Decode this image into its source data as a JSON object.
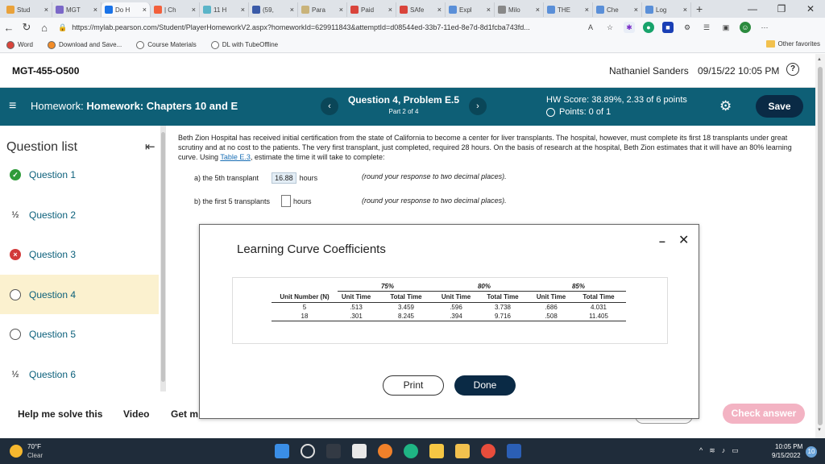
{
  "browser": {
    "tabs": [
      {
        "label": "Stud",
        "color": "#e9a23b"
      },
      {
        "label": "MGT",
        "color": "#7b68c8"
      },
      {
        "label": "Do H",
        "color": "#1a73e8",
        "active": true
      },
      {
        "label": "| Ch",
        "color": "#f2603c"
      },
      {
        "label": "11 H",
        "color": "#5ab4c8"
      },
      {
        "label": "(59,",
        "color": "#3a5aa8"
      },
      {
        "label": "Para",
        "color": "#c9b37a"
      },
      {
        "label": "Paid",
        "color": "#d9443b"
      },
      {
        "label": "SAfe",
        "color": "#d9443b"
      },
      {
        "label": "Expl",
        "color": "#5a8fd8"
      },
      {
        "label": "Milo",
        "color": "#888888"
      },
      {
        "label": "THE",
        "color": "#5a8fd8"
      },
      {
        "label": "Che",
        "color": "#5a8fd8"
      },
      {
        "label": "Log",
        "color": "#5a8fd8"
      }
    ],
    "tab_close": "×",
    "new_tab": "+",
    "window_controls": {
      "minimize": "—",
      "restore": "❐",
      "close": "✕"
    },
    "url": "https://mylab.pearson.com/Student/PlayerHomeworkV2.aspx?homeworkId=629911843&attemptId=d08544ed-33b7-11ed-8e7d-8d1fcba743fd...",
    "bookmarks": [
      {
        "label": "Word",
        "color": "#d9443b"
      },
      {
        "label": "Download and Save...",
        "color": "#f28c28"
      },
      {
        "label": "Course Materials",
        "color": "#ffffff"
      },
      {
        "label": "DL with TubeOffline",
        "color": "#ffffff"
      }
    ],
    "other_favorites": "Other favorites"
  },
  "header": {
    "course": "MGT-455-O500",
    "user": "Nathaniel Sanders",
    "datetime": "09/15/22 10:05 PM",
    "help_icon": "?"
  },
  "hwbar": {
    "menu_icon": "≡",
    "hw_prefix": "Homework:",
    "hw_title": "Homework: Chapters 10 and E",
    "question_title": "Question 4, Problem E.5",
    "question_part": "Part 2 of 4",
    "prev_icon": "‹",
    "next_icon": "›",
    "hw_score": "HW Score: 38.89%, 2.33 of 6 points",
    "points": "Points: 0 of 1",
    "gear_icon": "⚙",
    "save_label": "Save",
    "bg_color": "#0e5f76"
  },
  "sidebar": {
    "title": "Question list",
    "collapse_icon": "⇤",
    "items": [
      {
        "label": "Question 1",
        "status": "correct"
      },
      {
        "label": "Question 2",
        "status": "partial"
      },
      {
        "label": "Question 3",
        "status": "incorrect"
      },
      {
        "label": "Question 4",
        "status": "current"
      },
      {
        "label": "Question 5",
        "status": "unanswered"
      },
      {
        "label": "Question 6",
        "status": "partial"
      }
    ],
    "partial_icon": "½",
    "correct_icon": "✓",
    "incorrect_icon": "×"
  },
  "question": {
    "text_before_link": "Beth Zion Hospital has received initial certification from the state of California to become a center for liver transplants. The hospital, however, must complete its first 18 transplants under great scrutiny and at no cost to the patients. The very first transplant, just completed, required 28 hours. On the basis of research at the hospital, Beth Zion estimates that it will have an 80% learning curve. Using ",
    "link_text": "Table E.3",
    "text_after_link": ", estimate the time it will take to complete:",
    "part_a_label": "a) the 5th transplant",
    "part_a_value": "16.88",
    "part_a_unit": "hours",
    "part_a_hint": "(round your response to two decimal places).",
    "part_b_label": "b) the first 5 transplants",
    "part_b_unit": "hours",
    "part_b_hint": "(round your response to two decimal places)."
  },
  "popup": {
    "title": "Learning Curve Coefficients",
    "minimize_icon": "–",
    "close_icon": "✕",
    "table": {
      "group_headers": [
        "75%",
        "80%",
        "85%"
      ],
      "columns": [
        "Unit Number (N)",
        "Unit Time",
        "Total Time",
        "Unit Time",
        "Total Time",
        "Unit Time",
        "Total Time"
      ],
      "rows": [
        [
          "5",
          ".513",
          "3.459",
          ".596",
          "3.738",
          ".686",
          "4.031"
        ],
        [
          "18",
          ".301",
          "8.245",
          ".394",
          "9.716",
          ".508",
          "11.405"
        ]
      ]
    },
    "print_label": "Print",
    "done_label": "Done"
  },
  "bottom": {
    "help_label": "Help me solve this",
    "video_label": "Video",
    "get_label": "Get m",
    "check_label": "Check answer"
  },
  "taskbar": {
    "temp": "70°F",
    "condition": "Clear",
    "time": "10:05 PM",
    "date": "9/15/2022",
    "notif_count": "10"
  }
}
